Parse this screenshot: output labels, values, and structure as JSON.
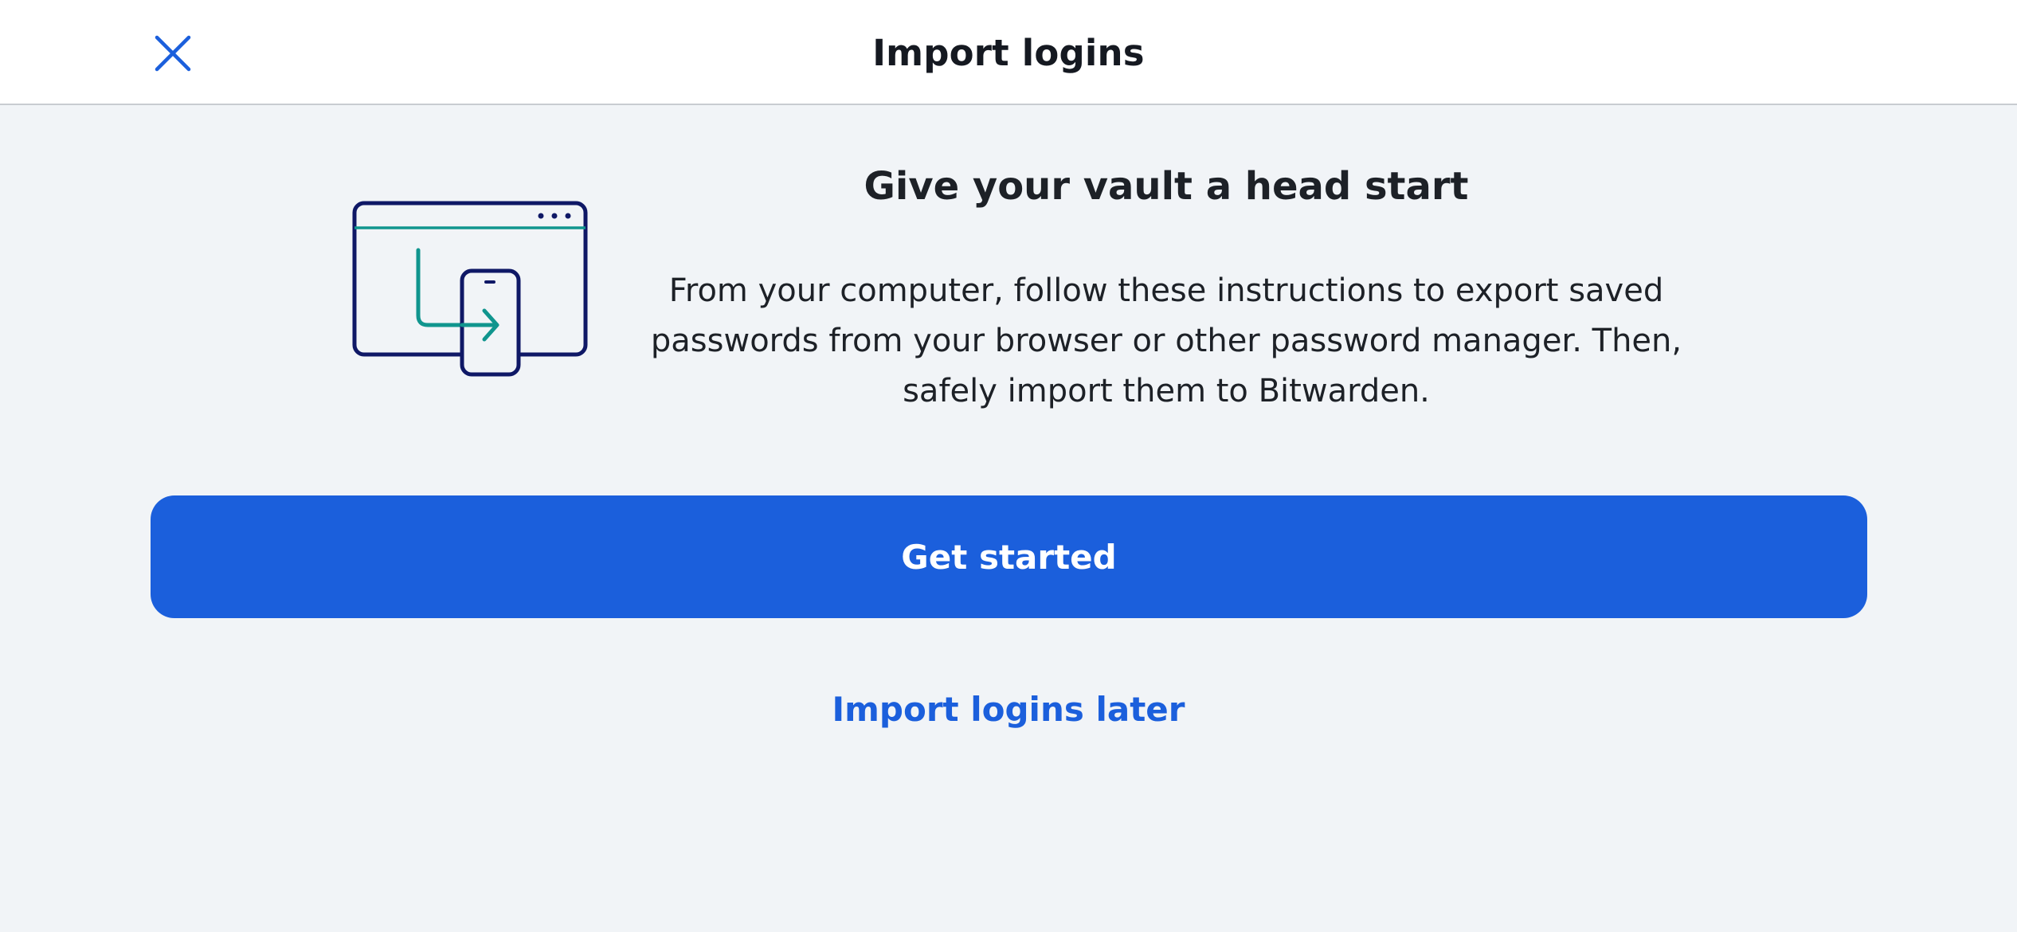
{
  "header": {
    "title": "Import logins",
    "close_icon": "close-icon"
  },
  "main": {
    "illustration_icon": "browser-to-phone-import-icon",
    "heading": "Give your vault a head start",
    "description": "From your computer, follow these instructions to export saved passwords from your browser or other password manager. Then, safely import them to Bitwarden.",
    "primary_button_label": "Get started",
    "secondary_link_label": "Import logins later"
  },
  "colors": {
    "accent": "#1b5fdc",
    "background": "#f1f4f7",
    "illustration_navy": "#0f1866",
    "illustration_teal": "#10958e"
  }
}
